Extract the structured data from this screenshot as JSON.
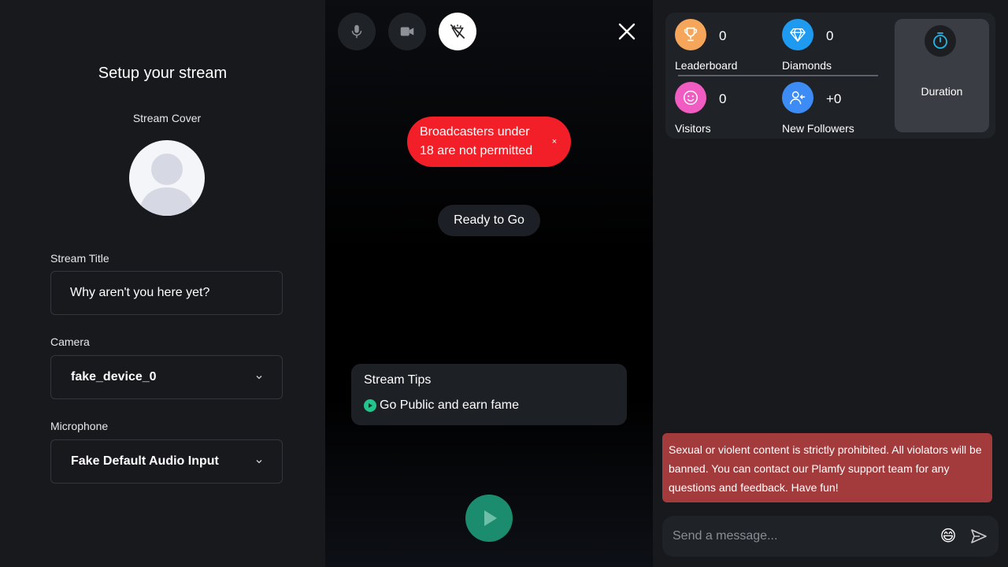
{
  "setup": {
    "title": "Setup your stream",
    "cover_label": "Stream Cover",
    "title_label": "Stream Title",
    "title_value": "Why aren't you here yet?",
    "camera_label": "Camera",
    "camera_value": "fake_device_0",
    "mic_label": "Microphone",
    "mic_value": "Fake Default Audio Input"
  },
  "preview": {
    "controls": [
      {
        "icon": "microphone-icon"
      },
      {
        "icon": "video-camera-icon"
      },
      {
        "icon": "effects-off-icon",
        "active": true
      }
    ],
    "warning": "Broadcasters under 18 are not permitted",
    "warning_close": "×",
    "status": "Ready to Go",
    "tips_title": "Stream Tips",
    "tips_item": "Go Public and earn fame"
  },
  "stats": {
    "leaderboard": {
      "value": "0",
      "label": "Leaderboard",
      "color": "#f5a65b"
    },
    "diamonds": {
      "value": "0",
      "label": "Diamonds",
      "color": "#1e9bf0"
    },
    "visitors": {
      "value": "0",
      "label": "Visitors",
      "color": "#f05cc2"
    },
    "followers": {
      "value": "+0",
      "label": "New Followers",
      "color": "#3d8bf5"
    },
    "duration": {
      "label": "Duration"
    }
  },
  "chat": {
    "rules": "Sexual or violent content is strictly prohibited. All violators will be banned. You can contact our Plamfy support team for any questions and feedback. Have fun!",
    "placeholder": "Send a message...",
    "emoji": "😄"
  },
  "colors": {
    "warning": "#f21f28",
    "go_button": "#1b8d6e",
    "rules_bg": "#a33a3c",
    "tips_dot": "#22c58b"
  }
}
